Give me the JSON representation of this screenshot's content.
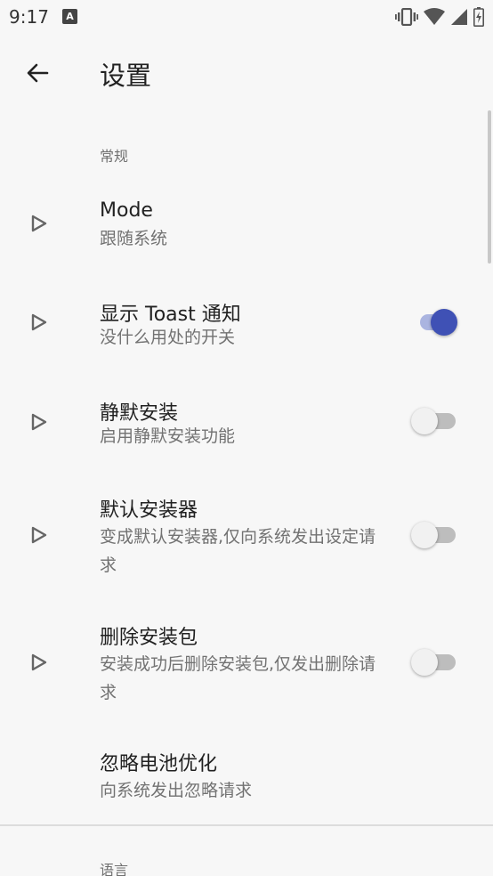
{
  "status_bar": {
    "time": "9:17",
    "notification_glyph": "A",
    "icons": [
      "vibrate-icon",
      "wifi-icon",
      "signal-icon",
      "battery-icon"
    ]
  },
  "app_bar": {
    "title": "设置",
    "back_icon": "arrow-back-icon"
  },
  "sections": [
    {
      "header": "常规",
      "items": [
        {
          "title": "Mode",
          "summary": "跟随系统",
          "icon": "play-arrow-icon"
        },
        {
          "title": "显示 Toast 通知",
          "summary": "没什么用处的开关",
          "icon": "play-arrow-icon",
          "switch_on": true
        },
        {
          "title": "静默安装",
          "summary": "启用静默安装功能",
          "icon": "play-arrow-icon",
          "switch_on": false
        },
        {
          "title": "默认安装器",
          "summary": "变成默认安装器,仅向系统发出设定请求",
          "icon": "play-arrow-icon",
          "switch_on": false
        },
        {
          "title": "删除安装包",
          "summary": "安装成功后删除安装包,仅发出删除请求",
          "icon": "play-arrow-icon",
          "switch_on": false
        },
        {
          "title": "忽略电池优化",
          "summary": "向系统发出忽略请求"
        }
      ]
    },
    {
      "header": "语言"
    }
  ],
  "colors": {
    "accent": "#3f51b5",
    "accent_track": "#aab4e0",
    "background": "#f7f7f7"
  }
}
